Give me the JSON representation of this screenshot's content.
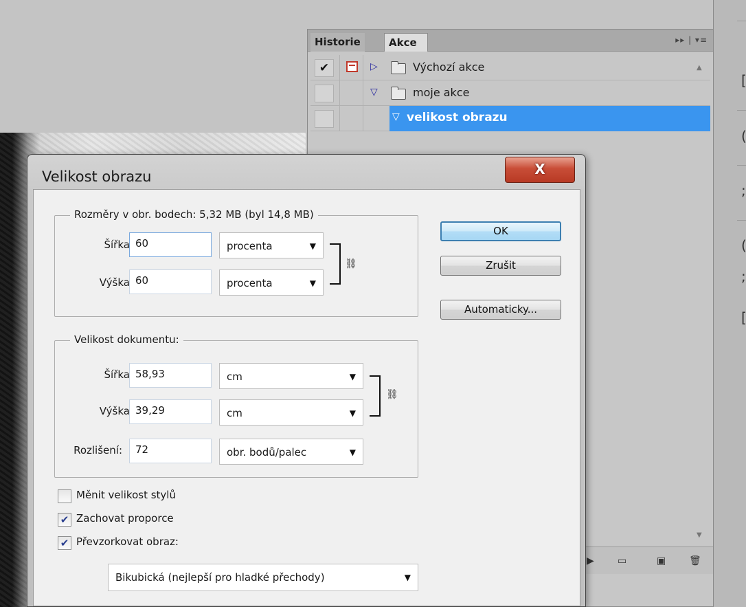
{
  "actions_panel": {
    "tabs": [
      "Historie",
      "Akce"
    ],
    "active_tab": "Akce",
    "controls": "▸▸ | ▾≡",
    "rows": [
      {
        "name": "Výchozí akce",
        "checked": "✔",
        "expanded": false
      },
      {
        "name": "moje akce",
        "checked": "",
        "expanded": true
      },
      {
        "name": "velikost obrazu",
        "checked": "",
        "expanded": true,
        "selected": true
      }
    ]
  },
  "dialog": {
    "title": "Velikost obrazu",
    "close_label": "X",
    "pixel_dims": {
      "legend": "Rozměry v obr. bodech:  5,32 MB (byl 14,8 MB)",
      "width_label": "Šířka:",
      "width_value": "60",
      "width_unit": "procenta",
      "height_label": "Výška:",
      "height_value": "60",
      "height_unit": "procenta"
    },
    "doc_size": {
      "legend": "Velikost dokumentu:",
      "width_label": "Šířka:",
      "width_value": "58,93",
      "width_unit": "cm",
      "height_label": "Výška:",
      "height_value": "39,29",
      "height_unit": "cm",
      "res_label": "Rozlišení:",
      "res_value": "72",
      "res_unit": "obr. bodů/palec"
    },
    "checkboxes": [
      {
        "label": "Měnit velikost stylů",
        "checked": false
      },
      {
        "label": "Zachovat proporce",
        "checked": true
      },
      {
        "label": "Převzorkovat obraz:",
        "checked": true
      }
    ],
    "resample_method": "Bikubická (nejlepší pro hladké přechody)",
    "buttons": {
      "ok": "OK",
      "cancel": "Zrušit",
      "auto": "Automaticky..."
    }
  },
  "colors": {
    "selection": "#3a95ef",
    "close_button": "#c84d37",
    "ok_border": "#3c7fb1"
  }
}
